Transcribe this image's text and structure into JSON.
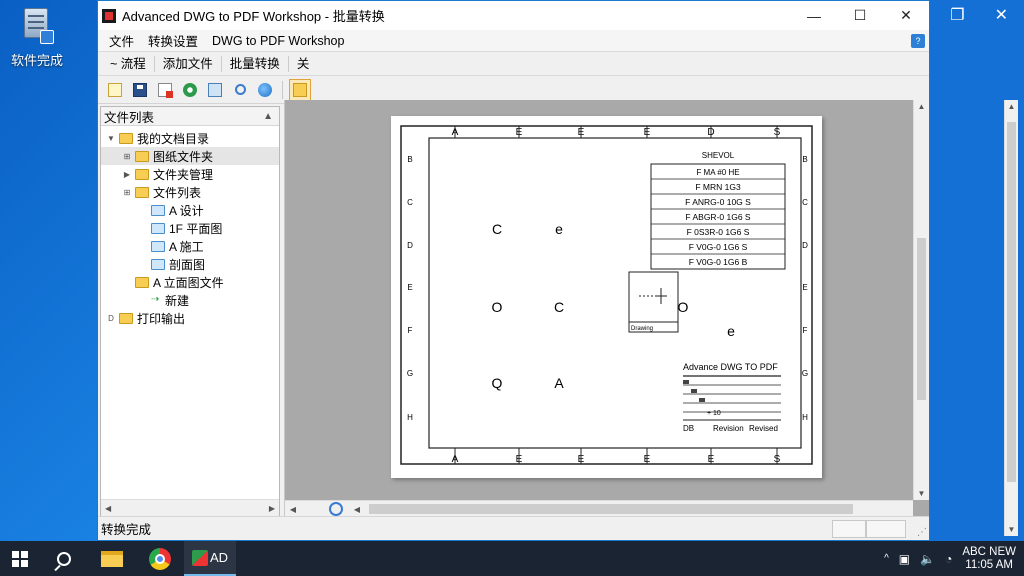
{
  "desktop": {
    "icon_label": "软件完成"
  },
  "window": {
    "title": "Advanced DWG to PDF Workshop - 批量转换",
    "controls": {
      "minimize": "—",
      "maximize": "☐",
      "close": "✕"
    }
  },
  "second_window": {
    "controls": {
      "restore": "❐",
      "close": "✕"
    }
  },
  "menu": {
    "items": [
      "文件",
      "转换设置",
      "DWG to PDF Workshop"
    ],
    "help_label": "?"
  },
  "tabs": [
    "~ 流程",
    "添加文件",
    "批量转换",
    "关"
  ],
  "toolbar": {
    "buttons": [
      {
        "name": "new",
        "icon": "document-icon"
      },
      {
        "name": "save",
        "icon": "save-icon"
      },
      {
        "name": "pdf",
        "icon": "pdf-icon"
      },
      {
        "name": "convert",
        "icon": "gear-icon"
      },
      {
        "name": "print",
        "icon": "print-icon"
      },
      {
        "name": "zoom",
        "icon": "zoom-icon"
      },
      {
        "name": "web",
        "icon": "web-icon"
      },
      {
        "name": "open-folder",
        "icon": "folder-icon"
      }
    ]
  },
  "tree": {
    "header": "文件列表",
    "nodes": [
      {
        "label": "我的文档目录",
        "twisty": "▼",
        "folder": "yellow",
        "indent": 0
      },
      {
        "label": "图纸文件夹",
        "twisty": "⊞",
        "folder": "yellow",
        "indent": 1,
        "selected": true
      },
      {
        "label": "文件夹管理",
        "twisty": "▶",
        "folder": "yellow",
        "indent": 1
      },
      {
        "label": "文件列表",
        "twisty": "⊞",
        "folder": "yellow",
        "indent": 1
      },
      {
        "label": "A 设计",
        "twisty": "",
        "folder": "blue",
        "indent": 2
      },
      {
        "label": "1F 平面图",
        "twisty": "",
        "folder": "blue",
        "indent": 2
      },
      {
        "label": "A 施工",
        "twisty": "",
        "folder": "blue",
        "indent": 2
      },
      {
        "label": "剖面图",
        "twisty": "",
        "folder": "blue",
        "indent": 2
      },
      {
        "label": "A 立面图文件",
        "twisty": "",
        "folder": "yellow",
        "indent": 1
      },
      {
        "label": "新建",
        "twisty": "",
        "folder": "green",
        "indent": 2
      },
      {
        "label": "打印输出",
        "twisty": "D",
        "folder": "yellow",
        "indent": 0
      }
    ]
  },
  "drawing": {
    "top_letters": [
      "A",
      "E",
      "E",
      "E",
      "D",
      "S"
    ],
    "bottom_letters": [
      "A",
      "E",
      "E",
      "E",
      "E",
      "S"
    ],
    "side_letters": [
      "B",
      "C",
      "D",
      "E",
      "F",
      "G",
      "H"
    ],
    "grid_labels": [
      {
        "t": "C",
        "row": 0,
        "col": 0
      },
      {
        "t": "e",
        "row": 0,
        "col": 1
      },
      {
        "t": "O",
        "row": 1,
        "col": 0
      },
      {
        "t": "C",
        "row": 1,
        "col": 1
      },
      {
        "t": "Q",
        "row": 2,
        "col": 0
      },
      {
        "t": "A",
        "row": 2,
        "col": 1
      },
      {
        "t": "O",
        "row": 1,
        "col": 3
      },
      {
        "t": "e",
        "row": 1,
        "col": 4
      }
    ],
    "schedule": {
      "title": "SHEVOL",
      "header": "F MA #0 HE",
      "rows": [
        "F MRN 1G3",
        "F ANRG-0 10G S",
        "F ABGR-0 1G6 S",
        "F 0S3R-0 1G6 S",
        "F V0G-0 1G6 S",
        "F V0G-0 1G6 B"
      ]
    },
    "detail_box": {
      "label": "Drawing"
    },
    "title_block": {
      "company": "Advance DWG TO PDF",
      "rows": [
        "",
        "",
        "",
        "",
        "+ 10"
      ],
      "footer": [
        "DB",
        "Revision",
        "Revised"
      ]
    }
  },
  "status": {
    "text": "转换完成"
  },
  "taskbar": {
    "app_label": "AD",
    "tray_chevron": "^",
    "clock_line1": "ABC NEW",
    "clock_line2": "11:05 AM"
  }
}
